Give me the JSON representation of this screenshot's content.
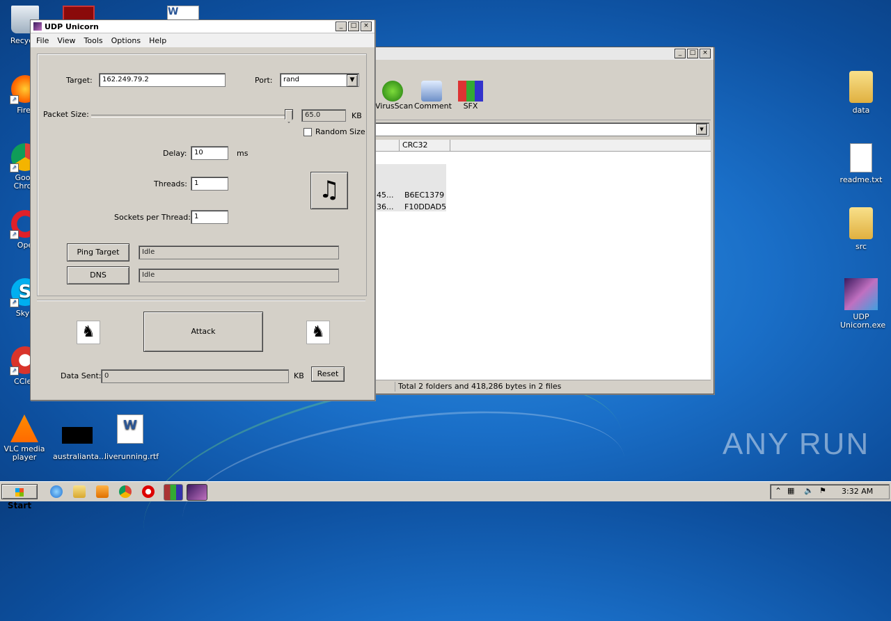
{
  "desktop": {
    "left_icons": [
      {
        "label": "Recycle",
        "icon": "recycle-bin-icon"
      },
      {
        "label": "Firef",
        "icon": "firefox-icon"
      },
      {
        "label": "Goog Chron",
        "icon": "chrome-icon"
      },
      {
        "label": "Ope",
        "icon": "opera-icon"
      },
      {
        "label": "Skyp",
        "icon": "skype-icon"
      },
      {
        "label": "CClea",
        "icon": "ccleaner-icon"
      },
      {
        "label": "VLC media player",
        "icon": "vlc-icon"
      },
      {
        "label": "australianta...",
        "icon": "black-file-icon"
      },
      {
        "label": "liverunning.rtf",
        "icon": "word-doc-icon"
      }
    ],
    "right_icons": [
      {
        "label": "data",
        "icon": "folder-icon"
      },
      {
        "label": "readme.txt",
        "icon": "text-file-icon"
      },
      {
        "label": "src",
        "icon": "folder-icon"
      },
      {
        "label": "UDP Unicorn.exe",
        "icon": "unicorn-exe-icon"
      }
    ],
    "watermark": "ANY RUN"
  },
  "winrar": {
    "toolbar": [
      {
        "label": "VirusScan",
        "icon": "virusscan-icon"
      },
      {
        "label": "Comment",
        "icon": "comment-icon"
      },
      {
        "label": "SFX",
        "icon": "sfx-icon"
      }
    ],
    "column_header": "CRC32",
    "rows": [
      {
        "size": "45...",
        "crc": "B6EC1379"
      },
      {
        "size": "36...",
        "crc": "F10DDAD5"
      }
    ],
    "status": "Total 2 folders and 418,286 bytes in 2 files"
  },
  "app": {
    "title": "UDP Unicorn",
    "menu": [
      "File",
      "View",
      "Tools",
      "Options",
      "Help"
    ],
    "target_label": "Target:",
    "target_value": "162.249.79.2",
    "port_label": "Port:",
    "port_value": "rand",
    "packet_size_label": "Packet Size:",
    "packet_size_value": "65.0",
    "packet_size_unit": "KB",
    "packet_size_fraction": 1.0,
    "random_size_label": "Random Size",
    "random_size_checked": false,
    "delay_label": "Delay:",
    "delay_value": "10",
    "delay_unit": "ms",
    "threads_label": "Threads:",
    "threads_value": "1",
    "sockets_label": "Sockets per Thread:",
    "sockets_value": "1",
    "music_icon": "♫",
    "ping_button": "Ping Target",
    "ping_status": "Idle",
    "dns_button": "DNS",
    "dns_status": "Idle",
    "attack_button": "Attack",
    "data_sent_label": "Data Sent:",
    "data_sent_value": "0",
    "data_sent_unit": "KB",
    "reset_button": "Reset"
  },
  "taskbar": {
    "start_label": "Start",
    "clock": "3:32 AM",
    "pinned": [
      "ie-icon",
      "explorer-icon",
      "media-player-icon",
      "chrome-icon",
      "opera-icon",
      "winrar-icon",
      "unicorn-icon"
    ]
  }
}
